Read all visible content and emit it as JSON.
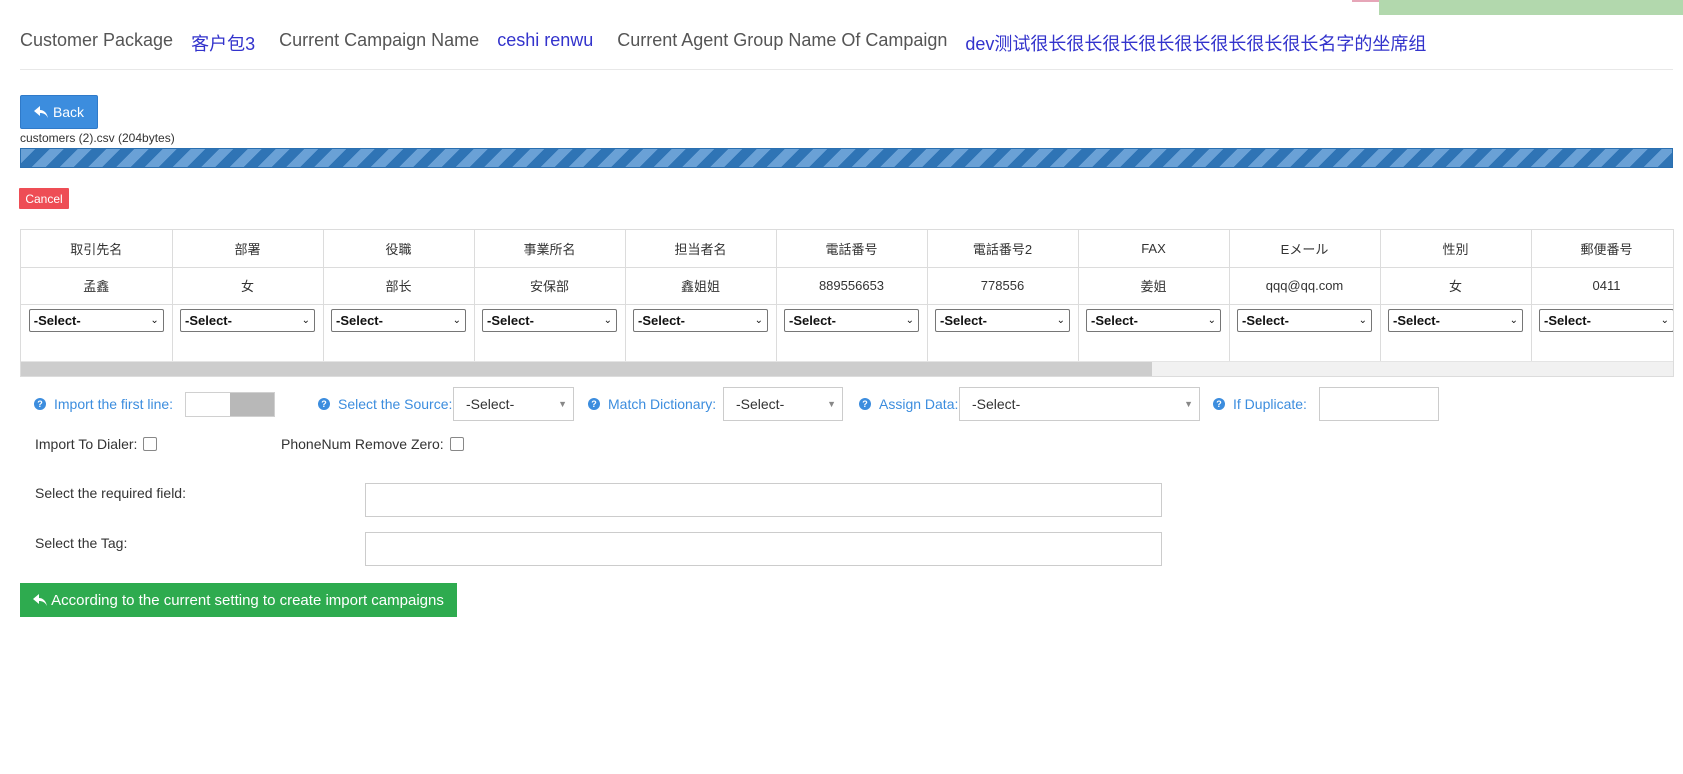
{
  "header": {
    "customer_package_label": "Customer Package",
    "customer_package_value": "客户包3",
    "campaign_label": "Current Campaign Name",
    "campaign_value": "ceshi renwu",
    "agent_group_label": "Current Agent Group Name Of Campaign",
    "agent_group_value": "dev测试很长很长很长很长很长很长很长很长名字的坐席组"
  },
  "back_button": {
    "icon": "reply-icon",
    "label": "Back"
  },
  "upload": {
    "file_name": "customers (2).csv (204bytes)",
    "progress_percent": 100,
    "progress_color": "#2f74b5",
    "cancel_label": "Cancel"
  },
  "mapping_table": {
    "headers": [
      "取引先名",
      "部署",
      "役職",
      "事業所名",
      "担当者名",
      "電話番号",
      "電話番号2",
      "FAX",
      "Eメール",
      "性別",
      "郵便番号"
    ],
    "sample_row": [
      "孟鑫",
      "女",
      "部长",
      "安保部",
      "鑫姐姐",
      "889556653",
      "778556",
      "姜姐",
      "qqq@qq.com",
      "女",
      "0411"
    ],
    "select_value": "-Select-"
  },
  "options": {
    "help_icon": "question-circle-icon",
    "import_first_line_label": "Import the first line:",
    "select_source_label": "Select the Source:",
    "select_source_value": "-Select-",
    "match_dictionary_label": "Match Dictionary:",
    "match_dictionary_value": "-Select-",
    "assign_data_label": "Assign Data:",
    "assign_data_value": "-Select-",
    "if_duplicate_label": "If Duplicate:",
    "import_to_dialer_label": "Import To Dialer:",
    "phonenum_remove_zero_label": "PhoneNum Remove Zero:",
    "required_field_label": "Select the required field:",
    "tag_label": "Select the Tag:"
  },
  "create_button": {
    "icon": "reply-icon",
    "label": "According to the current setting to create import campaigns"
  },
  "colors": {
    "primary": "#3c8dde",
    "success": "#2eab4f",
    "danger": "#ee4d55",
    "link": "#3333cc"
  }
}
